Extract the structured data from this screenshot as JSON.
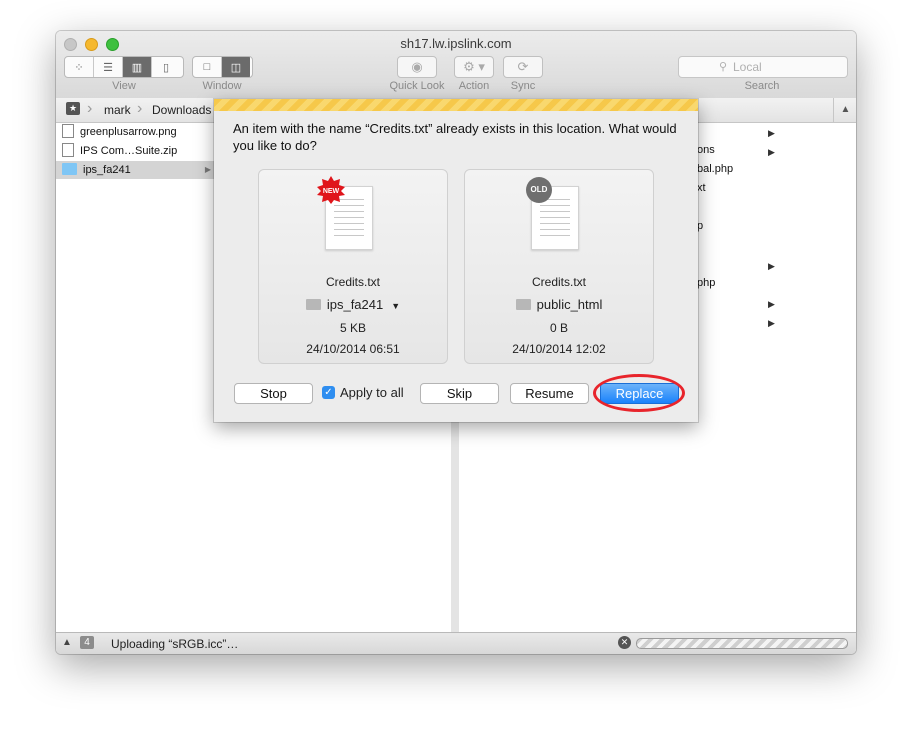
{
  "window": {
    "title": "sh17.lw.ipslink.com",
    "toolbar": {
      "view_label": "View",
      "window_label": "Window",
      "quicklook_label": "Quick Look",
      "action_label": "Action",
      "sync_label": "Sync",
      "search_label": "Search",
      "search_placeholder": "Local"
    },
    "path": [
      "mark",
      "Downloads"
    ]
  },
  "left_column": {
    "items": [
      {
        "name": "greenplusarrow.png",
        "type": "image"
      },
      {
        "name": "IPS Com…Suite.zip",
        "type": "archive"
      },
      {
        "name": "ips_fa241",
        "type": "folder",
        "selected": true
      }
    ]
  },
  "right_column_partial": [
    "ons",
    "bal.php",
    "xt",
    "p",
    "php"
  ],
  "status_bar": {
    "count_badge": "4",
    "message": "Uploading “sRGB.icc”…"
  },
  "dialog": {
    "message": "An item with the name “Credits.txt” already exists in this location. What would you like to do?",
    "new_item": {
      "badge": "NEW",
      "filename": "Credits.txt",
      "folder": "ips_fa241",
      "size": "5 KB",
      "date": "24/10/2014 06:51"
    },
    "old_item": {
      "badge": "OLD",
      "filename": "Credits.txt",
      "folder": "public_html",
      "size": "0 B",
      "date": "24/10/2014 12:02"
    },
    "buttons": {
      "stop": "Stop",
      "apply_to_all": "Apply to all",
      "apply_to_all_checked": true,
      "skip": "Skip",
      "resume": "Resume",
      "replace": "Replace"
    }
  },
  "colors": {
    "accent": "#1a82fb",
    "highlight_ring": "#e8242b",
    "stripe": "#f6c84a"
  }
}
